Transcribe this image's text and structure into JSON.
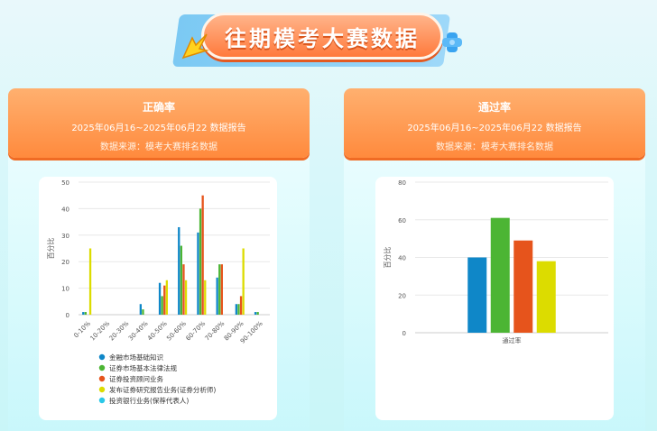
{
  "banner": {
    "title": "往期模考大赛数据"
  },
  "cards": [
    {
      "title": "正确率",
      "date_range": "2025年06月16~2025年06月22 数据报告",
      "source": "数据来源：模考大赛排名数据"
    },
    {
      "title": "通过率",
      "date_range": "2025年06月16~2025年06月22 数据报告",
      "source": "数据来源：模考大赛排名数据"
    }
  ],
  "colors": {
    "series": [
      "#0f87c8",
      "#4cb534",
      "#e6541c",
      "#dcdc00",
      "#2bc8e8"
    ],
    "accent": "#ff8a3d"
  },
  "chart_data": [
    {
      "type": "bar",
      "categories": [
        "0-10%",
        "10-20%",
        "20-30%",
        "30-40%",
        "40-50%",
        "50-60%",
        "60-70%",
        "70-80%",
        "80-90%",
        "90-100%"
      ],
      "ylabel": "百分比",
      "ylim": [
        0,
        50
      ],
      "yticks": [
        0,
        10,
        20,
        30,
        40,
        50
      ],
      "grid": true,
      "legend_position": "bottom",
      "series": [
        {
          "name": "金融市场基础知识",
          "values": [
            1,
            0,
            0,
            4,
            12,
            33,
            31,
            14,
            4,
            1
          ]
        },
        {
          "name": "证券市场基本法律法规",
          "values": [
            1,
            0,
            0,
            2,
            7,
            26,
            40,
            19,
            4,
            1
          ]
        },
        {
          "name": "证券投资顾问业务",
          "values": [
            0,
            0,
            0,
            0,
            11,
            19,
            45,
            19,
            7,
            0
          ]
        },
        {
          "name": "发布证券研究报告业务(证券分析师)",
          "values": [
            25,
            0,
            0,
            0,
            13,
            13,
            13,
            0,
            25,
            0
          ]
        },
        {
          "name": "投资银行业务(保荐代表人)",
          "values": [
            0,
            0,
            0,
            0,
            0,
            0,
            0,
            0,
            0,
            0
          ]
        }
      ]
    },
    {
      "type": "bar",
      "categories": [
        "通过率"
      ],
      "ylabel": "百分比",
      "ylim": [
        0,
        80
      ],
      "yticks": [
        0,
        20,
        40,
        60,
        80
      ],
      "grid": true,
      "series": [
        {
          "name": "金融市场基础知识",
          "values": [
            40
          ]
        },
        {
          "name": "证券市场基本法律法规",
          "values": [
            61
          ]
        },
        {
          "name": "证券投资顾问业务",
          "values": [
            49
          ]
        },
        {
          "name": "发布证券研究报告业务(证券分析师)",
          "values": [
            38
          ]
        }
      ]
    }
  ]
}
